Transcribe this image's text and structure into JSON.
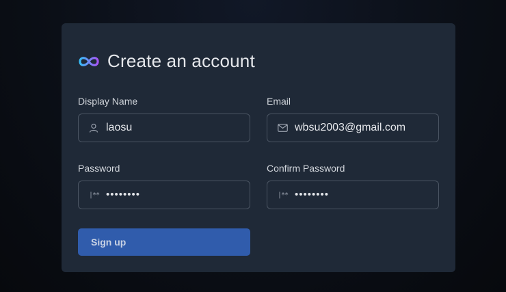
{
  "form": {
    "title": "Create an account",
    "logo_icon": "infinity-logo-icon",
    "fields": {
      "display_name": {
        "label": "Display Name",
        "value": "laosu",
        "icon": "user-icon"
      },
      "email": {
        "label": "Email",
        "value": "wbsu2003@gmail.com",
        "icon": "mail-icon"
      },
      "password": {
        "label": "Password",
        "value": "••••••••",
        "icon": "password-icon"
      },
      "confirm_password": {
        "label": "Confirm Password",
        "value": "••••••••",
        "icon": "password-icon"
      }
    },
    "submit_label": "Sign up"
  },
  "colors": {
    "background": "#0b0f17",
    "card": "#1f2937",
    "input_border": "#4b5563",
    "button": "#305cac",
    "logo_gradient": [
      "#38bdf8",
      "#a855f7"
    ]
  }
}
